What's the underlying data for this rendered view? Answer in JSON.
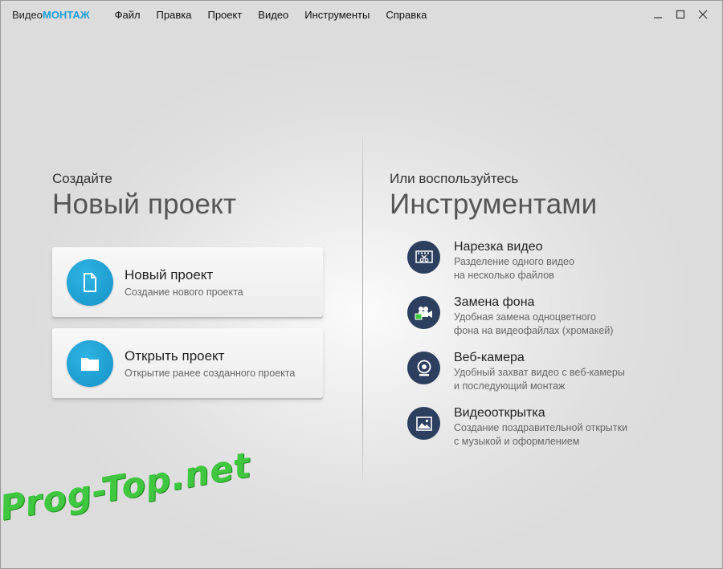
{
  "app": {
    "title_prefix": "Видео",
    "title_accent": "МОНТАЖ"
  },
  "menu": [
    "Файл",
    "Правка",
    "Проект",
    "Видео",
    "Инструменты",
    "Справка"
  ],
  "left": {
    "subtitle": "Создайте",
    "title": "Новый проект",
    "cards": [
      {
        "title": "Новый проект",
        "desc": "Создание нового проекта",
        "icon": "document-icon"
      },
      {
        "title": "Открыть проект",
        "desc": "Открытие ранее созданного проекта",
        "icon": "folder-icon"
      }
    ]
  },
  "right": {
    "subtitle": "Или воспользуйтесь",
    "title": "Инструментами",
    "tools": [
      {
        "title": "Нарезка видео",
        "desc1": "Разделение одного видео",
        "desc2": "на несколько файлов",
        "icon": "film-cut-icon"
      },
      {
        "title": "Замена фона",
        "desc1": "Удобная замена одноцветного",
        "desc2": "фона на видеофайлах (хромакей)",
        "icon": "chroma-camera-icon"
      },
      {
        "title": "Веб-камера",
        "desc1": "Удобный захват видео с веб-камеры",
        "desc2": "и последующий монтаж",
        "icon": "webcam-icon"
      },
      {
        "title": "Видеооткрытка",
        "desc1": "Создание поздравительной открытки",
        "desc2": "с музыкой и оформлением",
        "icon": "postcard-image-icon"
      }
    ]
  },
  "watermark": "Prog-Top.net",
  "colors": {
    "accent": "#1f9fd6",
    "card_icon": "#1a9fd4",
    "tool_icon": "#2d3f5e",
    "watermark": "#3fc83f"
  }
}
